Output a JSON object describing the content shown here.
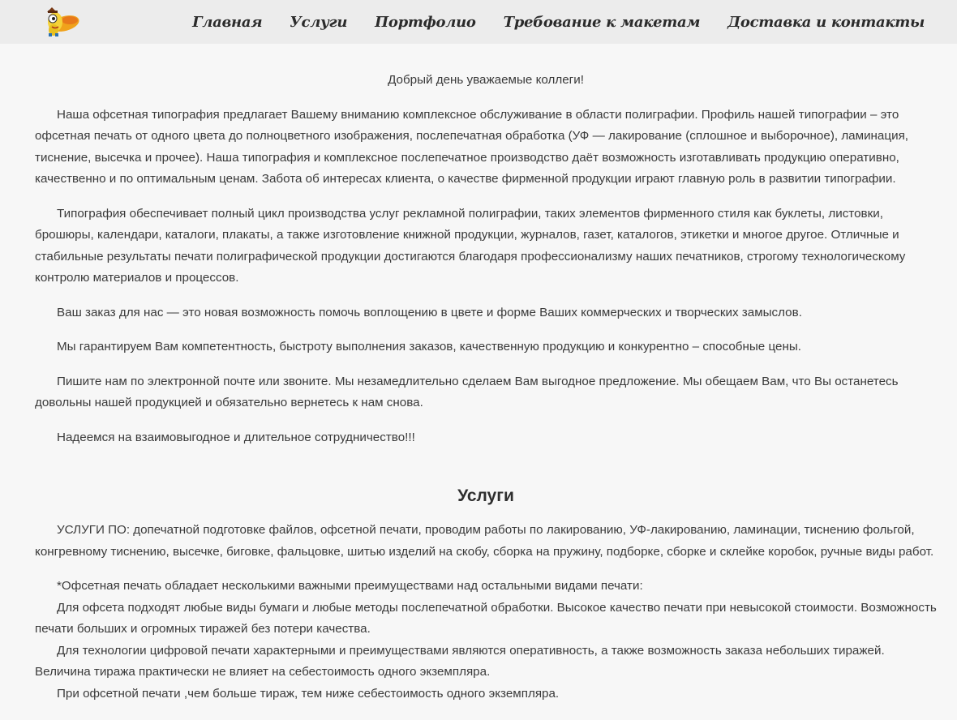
{
  "header": {
    "logo_icon": "cartoon-mascot-logo",
    "nav": [
      "Главная",
      "Услуги",
      "Портфолио",
      "Требование к макетам",
      "Доставка и контакты"
    ]
  },
  "intro": {
    "greeting": "Добрый день уважаемые коллеги!",
    "paragraphs": [
      "Наша офсетная типография предлагает Вашему вниманию комплексное обслуживание в области полиграфии. Профиль нашей типографии – это офсетная печать от одного цвета до полноцветного изображения, послепечатная обработка (УФ — лакирование (сплошное и выборочное), ламинация, тиснение, высечка и прочее). Наша типография и комплексное послепечатное производство даёт возможность изготавливать продукцию оперативно, качественно и по оптимальным ценам. Забота об интересах клиента, о качестве фирменной продукции играют главную роль в развитии типографии.",
      "Типография обеспечивает полный цикл производства услуг рекламной полиграфии, таких элементов фирменного стиля как буклеты, листовки, брошюры, календари, каталоги, плакаты, а также изготовление книжной продукции, журналов, газет, каталогов, этикетки и многое другое. Отличные и стабильные результаты печати полиграфической продукции достигаются благодаря профессионализму наших печатников, строгому технологическому контролю материалов и процессов.",
      "Ваш заказ для нас — это новая возможность помочь воплощению в цвете и форме Ваших коммерческих и творческих замыслов.",
      "Мы гарантируем Вам компетентность, быстроту выполнения заказов, качественную продукцию и конкурентно – способные цены.",
      "Пишите нам по электронной почте или звоните. Мы незамедлительно сделаем Вам выгодное предложение. Мы обещаем Вам, что Вы останетесь довольны нашей продукцией и обязательно вернетесь к нам снова.",
      "Надеемся на взаимовыгодное и длительное сотрудничество!!!"
    ]
  },
  "services": {
    "title": "Услуги",
    "summary": "УСЛУГИ ПО: допечатной подготовке файлов, офсетной печати, проводим работы по лакированию, УФ-лакированию, ламинации, тиснению фольгой, конгревному тиснению, высечке, биговке, фальцовке, шитью изделий на скобу, сборка на пружину, подборке, сборке и склейке коробок, ручные виды работ.",
    "details": [
      "*Офсетная печать обладает несколькими важными преимуществами над остальными видами печати:",
      "Для офсета подходят любые виды бумаги и любые методы послепечатной обработки. Высокое качество печати при невысокой стоимости. Возможность печати больших и огромных тиражей без потери качества.",
      "Для технологии цифровой печати характерными и преимуществами являются оперативность, а также возможность заказа небольших тиражей. Величина тиража практически не влияет на себестоимость одного экземпляра.",
      "При офсетной печати ,чем больше тираж, тем ниже себестоимость одного экземпляра."
    ]
  }
}
